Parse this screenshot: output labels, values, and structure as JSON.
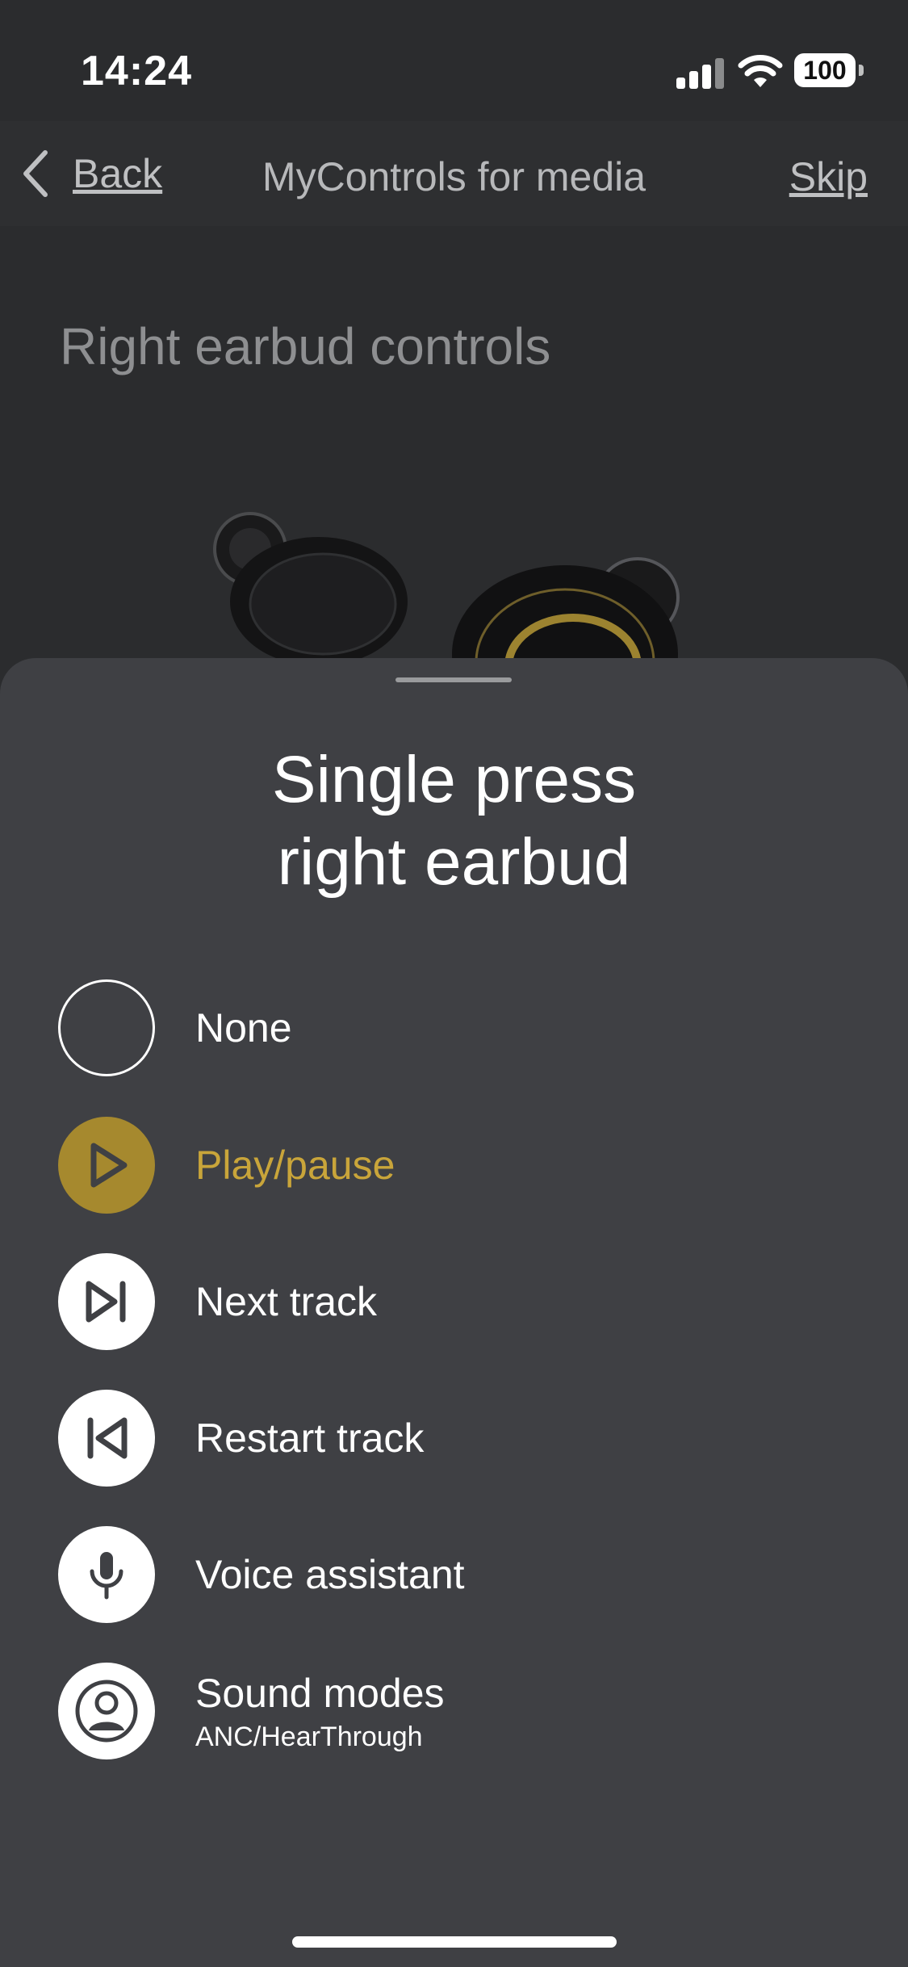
{
  "status_bar": {
    "time": "14:24",
    "battery": "100"
  },
  "nav": {
    "back_label": "Back",
    "title": "MyControls for media",
    "skip_label": "Skip"
  },
  "page": {
    "section_title": "Right earbud controls"
  },
  "sheet": {
    "title_line1": "Single press",
    "title_line2": "right earbud",
    "options": [
      {
        "label": "None",
        "sublabel": "",
        "icon": "empty-circle-icon",
        "selected": false
      },
      {
        "label": "Play/pause",
        "sublabel": "",
        "icon": "play-icon",
        "selected": true
      },
      {
        "label": "Next track",
        "sublabel": "",
        "icon": "next-track-icon",
        "selected": false
      },
      {
        "label": "Restart track",
        "sublabel": "",
        "icon": "restart-track-icon",
        "selected": false
      },
      {
        "label": "Voice assistant",
        "sublabel": "",
        "icon": "microphone-icon",
        "selected": false
      },
      {
        "label": "Sound modes",
        "sublabel": "ANC/HearThrough",
        "icon": "person-icon",
        "selected": false
      }
    ]
  },
  "colors": {
    "accent": "#c9a53a",
    "sheet_bg": "#3f4044",
    "page_bg": "#2b2c2e"
  }
}
